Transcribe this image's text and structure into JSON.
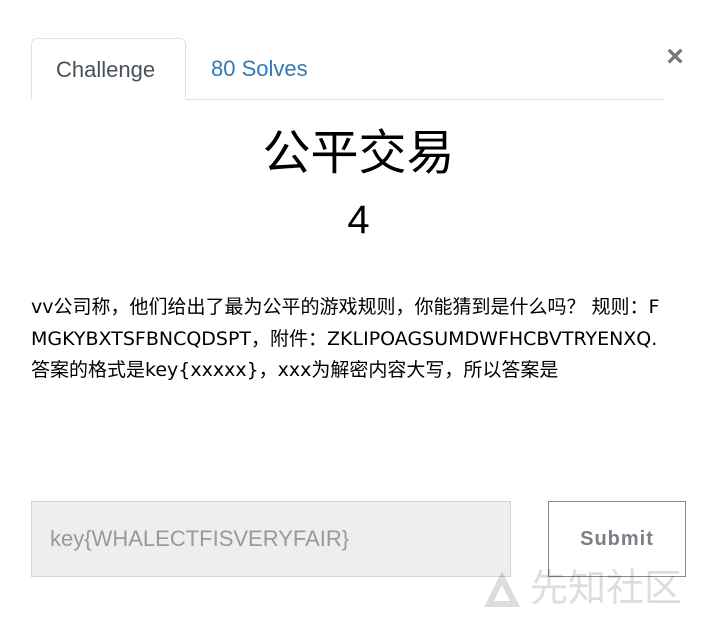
{
  "close_label": "×",
  "tabs": [
    {
      "label": "Challenge"
    },
    {
      "label": "80 Solves"
    }
  ],
  "challenge": {
    "title": "公平交易",
    "points": "4",
    "description": "vv公司称，他们给出了最为公平的游戏规则，你能猜到是什么吗？ 规则：FMGKYBXTSFBNCQDSPT，附件：ZKLIPOAGSUMDWFHCBVTRYENXQ. 答案的格式是key{xxxxx}，xxx为解密内容大写，所以答案是"
  },
  "flag_input": {
    "value": "key{WHALECTFISVERYFAIR}"
  },
  "submit_label": "Submit",
  "watermark_text": "先知社区",
  "colors": {
    "tab_link": "#337ab7",
    "input_bg": "#eeeeee",
    "submit_text": "#7b8087"
  }
}
